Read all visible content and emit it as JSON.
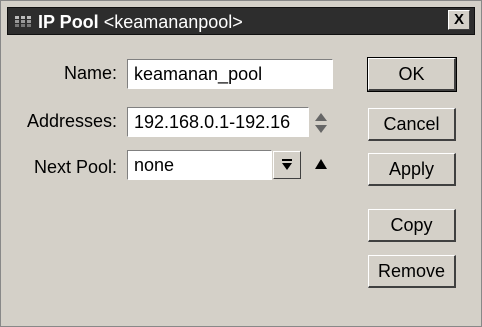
{
  "window": {
    "title_prefix": "IP Pool",
    "title_name": "<keamananpool>",
    "close_label": "X"
  },
  "form": {
    "name_label": "Name:",
    "name_value": "keamanan_pool",
    "addresses_label": "Addresses:",
    "addresses_value": "192.168.0.1-192.16",
    "next_pool_label": "Next Pool:",
    "next_pool_value": "none"
  },
  "buttons": {
    "ok": "OK",
    "cancel": "Cancel",
    "apply": "Apply",
    "copy": "Copy",
    "remove": "Remove"
  },
  "icons": {
    "app": "winbox-app-icon",
    "close": "close-icon",
    "stepper": "up-down-stepper-icon",
    "dropdown": "dropdown-arrow-icon",
    "remove_field": "up-arrow-icon"
  }
}
